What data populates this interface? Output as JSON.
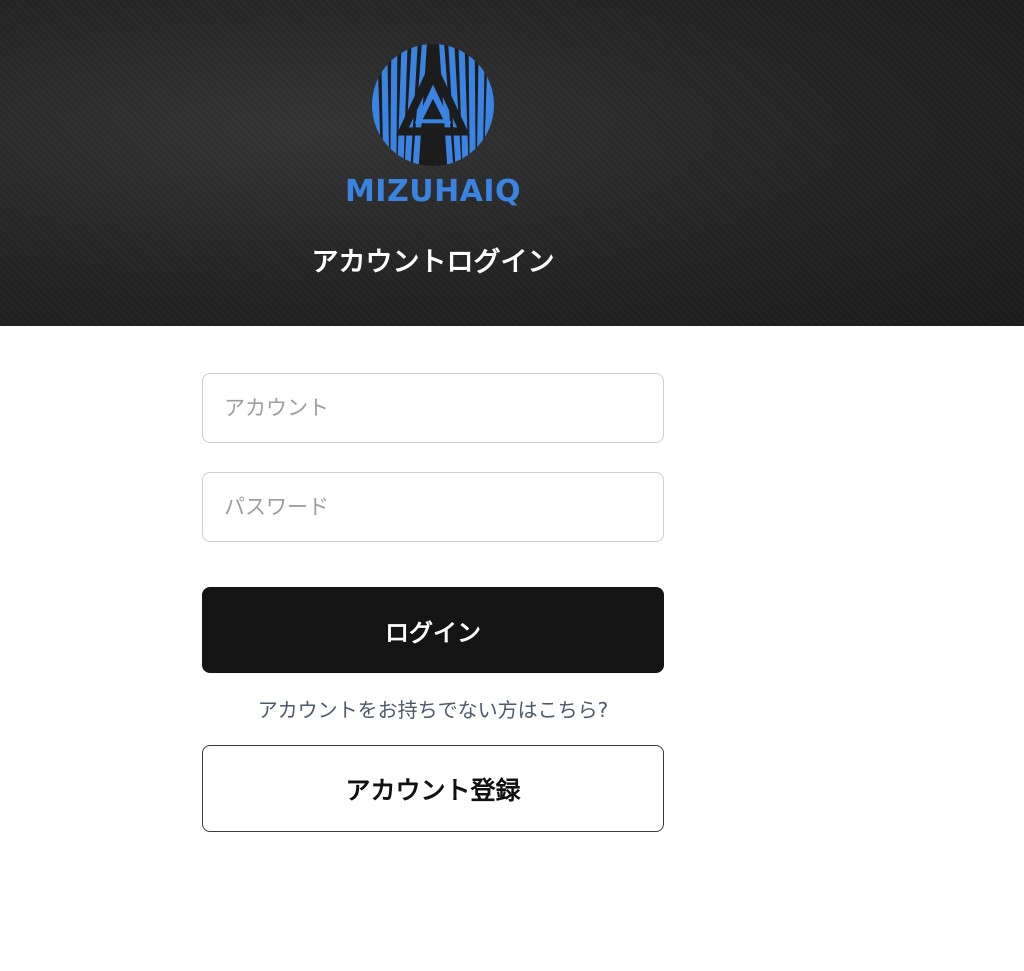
{
  "header": {
    "brand_name": "MIZUHAIQ",
    "title": "アカウントログイン",
    "logo_icon": "striped-globe-triangle-logo",
    "brand_color": "#3a83e0",
    "background_color": "#262626"
  },
  "form": {
    "account_placeholder": "アカウント",
    "account_value": "",
    "password_placeholder": "パスワード",
    "password_value": "",
    "login_label": "ログイン",
    "register_prompt": "アカウントをお持ちでない方はこちら?",
    "register_label": "アカウント登録"
  }
}
